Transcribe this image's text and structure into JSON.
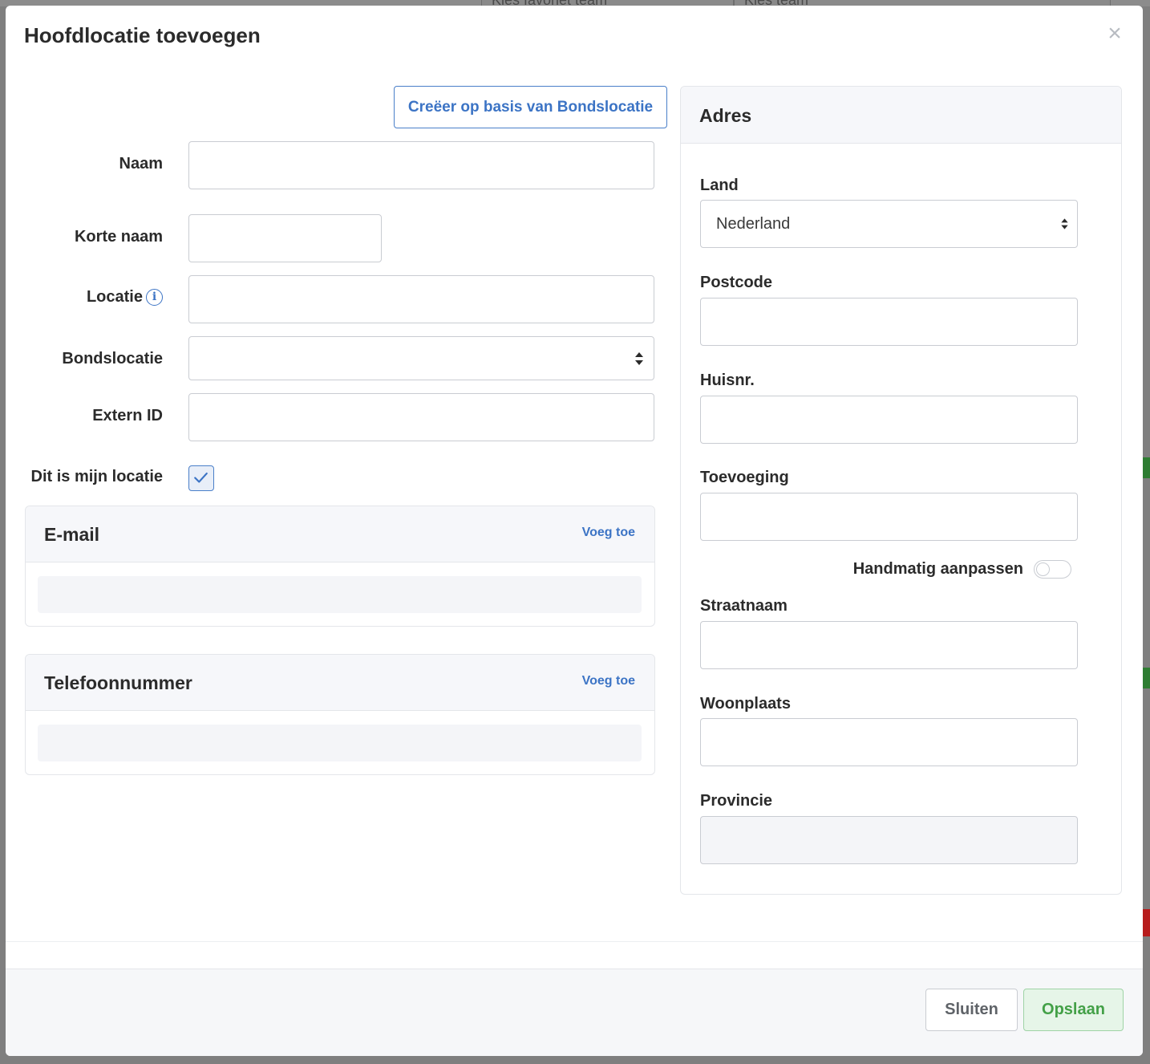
{
  "background": {
    "select_left_value": "Kies favoriet team",
    "select_right_value": "Kies team"
  },
  "modal": {
    "title": "Hoofdlocatie toevoegen",
    "close_symbol": "×"
  },
  "left": {
    "create_button_label": "Creëer op basis van Bondslocatie",
    "fields": {
      "naam_label": "Naam",
      "korte_naam_label": "Korte naam",
      "locatie_label": "Locatie",
      "bondslocatie_label": "Bondslocatie",
      "extern_id_label": "Extern ID",
      "dit_is_mijn_locatie_label": "Dit is mijn locatie"
    },
    "dit_is_mijn_locatie_checked": true,
    "email_card": {
      "title": "E-mail",
      "add_link": "Voeg toe"
    },
    "phone_card": {
      "title": "Telefoonnummer",
      "add_link": "Voeg toe"
    }
  },
  "address": {
    "title": "Adres",
    "land_label": "Land",
    "land_value": "Nederland",
    "postcode_label": "Postcode",
    "huisnr_label": "Huisnr.",
    "toevoeging_label": "Toevoeging",
    "handmatig_label": "Handmatig aanpassen",
    "handmatig_on": false,
    "straatnaam_label": "Straatnaam",
    "woonplaats_label": "Woonplaats",
    "provincie_label": "Provincie"
  },
  "footer": {
    "close_label": "Sluiten",
    "save_label": "Opslaan"
  },
  "colors": {
    "accent_blue": "#3c74c5",
    "save_green": "#43a047",
    "save_bg": "#e6f5e8"
  }
}
